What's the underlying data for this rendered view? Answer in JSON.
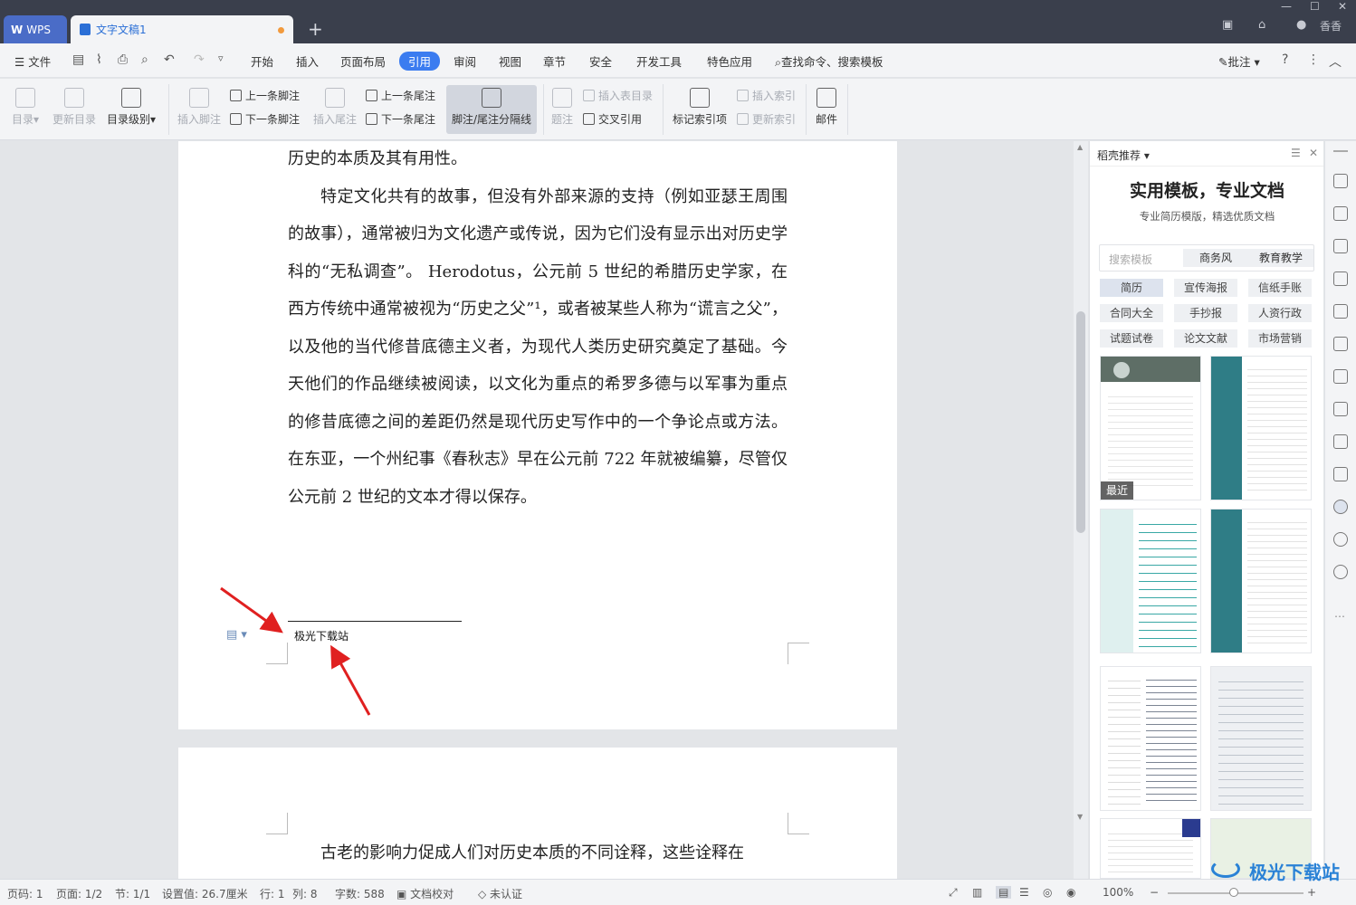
{
  "app": {
    "name": "WPS",
    "doc_tab": "文字文稿1"
  },
  "titlebar": {
    "user": "香香"
  },
  "menu": {
    "file": "文件",
    "tabs": [
      "开始",
      "插入",
      "页面布局",
      "引用",
      "审阅",
      "视图",
      "章节",
      "安全",
      "开发工具",
      "特色应用"
    ],
    "active_tab": "引用",
    "search": "查找命令、搜索模板",
    "comment": "批注"
  },
  "ribbon": {
    "toc": "目录",
    "update_toc": "更新目录",
    "toc_level": "目录级别",
    "insert_footnote": "插入脚注",
    "prev_footnote": "上一条脚注",
    "next_footnote": "下一条脚注",
    "insert_endnote": "插入尾注",
    "prev_endnote": "上一条尾注",
    "next_endnote": "下一条尾注",
    "separator": "脚注/尾注分隔线",
    "caption": "题注",
    "insert_table_toc": "插入表目录",
    "cross_ref": "交叉引用",
    "mark_index": "标记索引项",
    "insert_index": "插入索引",
    "update_index": "更新索引",
    "mail": "邮件"
  },
  "document": {
    "p1_end": "历史的本质及其有用性。",
    "p2": "特定文化共有的故事，但没有外部来源的支持（例如亚瑟王周围的故事），通常被归为文化遗产或传说，因为它们没有显示出对历史学科的“无私调查”。 Herodotus，公元前 5 世纪的希腊历史学家，在西方传统中通常被视为“历史之父”¹，或者被某些人称为“谎言之父”，以及他的当代修昔底德主义者，为现代人类历史研究奠定了基础。今天他们的作品继续被阅读，以文化为重点的希罗多德与以军事为重点的修昔底德之间的差距仍然是现代历史写作中的一个争论点或方法。在东亚，一个州纪事《春秋志》早在公元前 722 年就被编纂，尽管仅公元前 2 世纪的文本才得以保存。",
    "footnote": "极光下载站",
    "p3_start": "古老的影响力促成人们对历史本质的不同诠释，这些诠释在"
  },
  "pane": {
    "title": "稻壳推荐",
    "headline": "实用模板，专业文档",
    "sub": "专业简历模版，精选优质文档",
    "search_placeholder": "搜索模板",
    "search_tags": [
      "商务风",
      "教育教学"
    ],
    "categories": [
      "简历",
      "宣传海报",
      "信纸手账",
      "合同大全",
      "手抄报",
      "人资行政",
      "试题试卷",
      "论文文献",
      "市场营销"
    ],
    "recent_badge": "最近"
  },
  "status": {
    "page_no": "页码: 1",
    "pages": "页面: 1/2",
    "section": "节: 1/1",
    "setting": "设置值: 26.7厘米",
    "row": "行: 1",
    "col": "列: 8",
    "words": "字数: 588",
    "proof": "文档校对",
    "cert": "未认证",
    "zoom": "100%"
  },
  "watermark": "极光下载站",
  "colors": {
    "accent": "#3b7cf0",
    "tabbar": "#3a3f4c",
    "arrow": "#e02020",
    "teal": "#2f7d86"
  }
}
